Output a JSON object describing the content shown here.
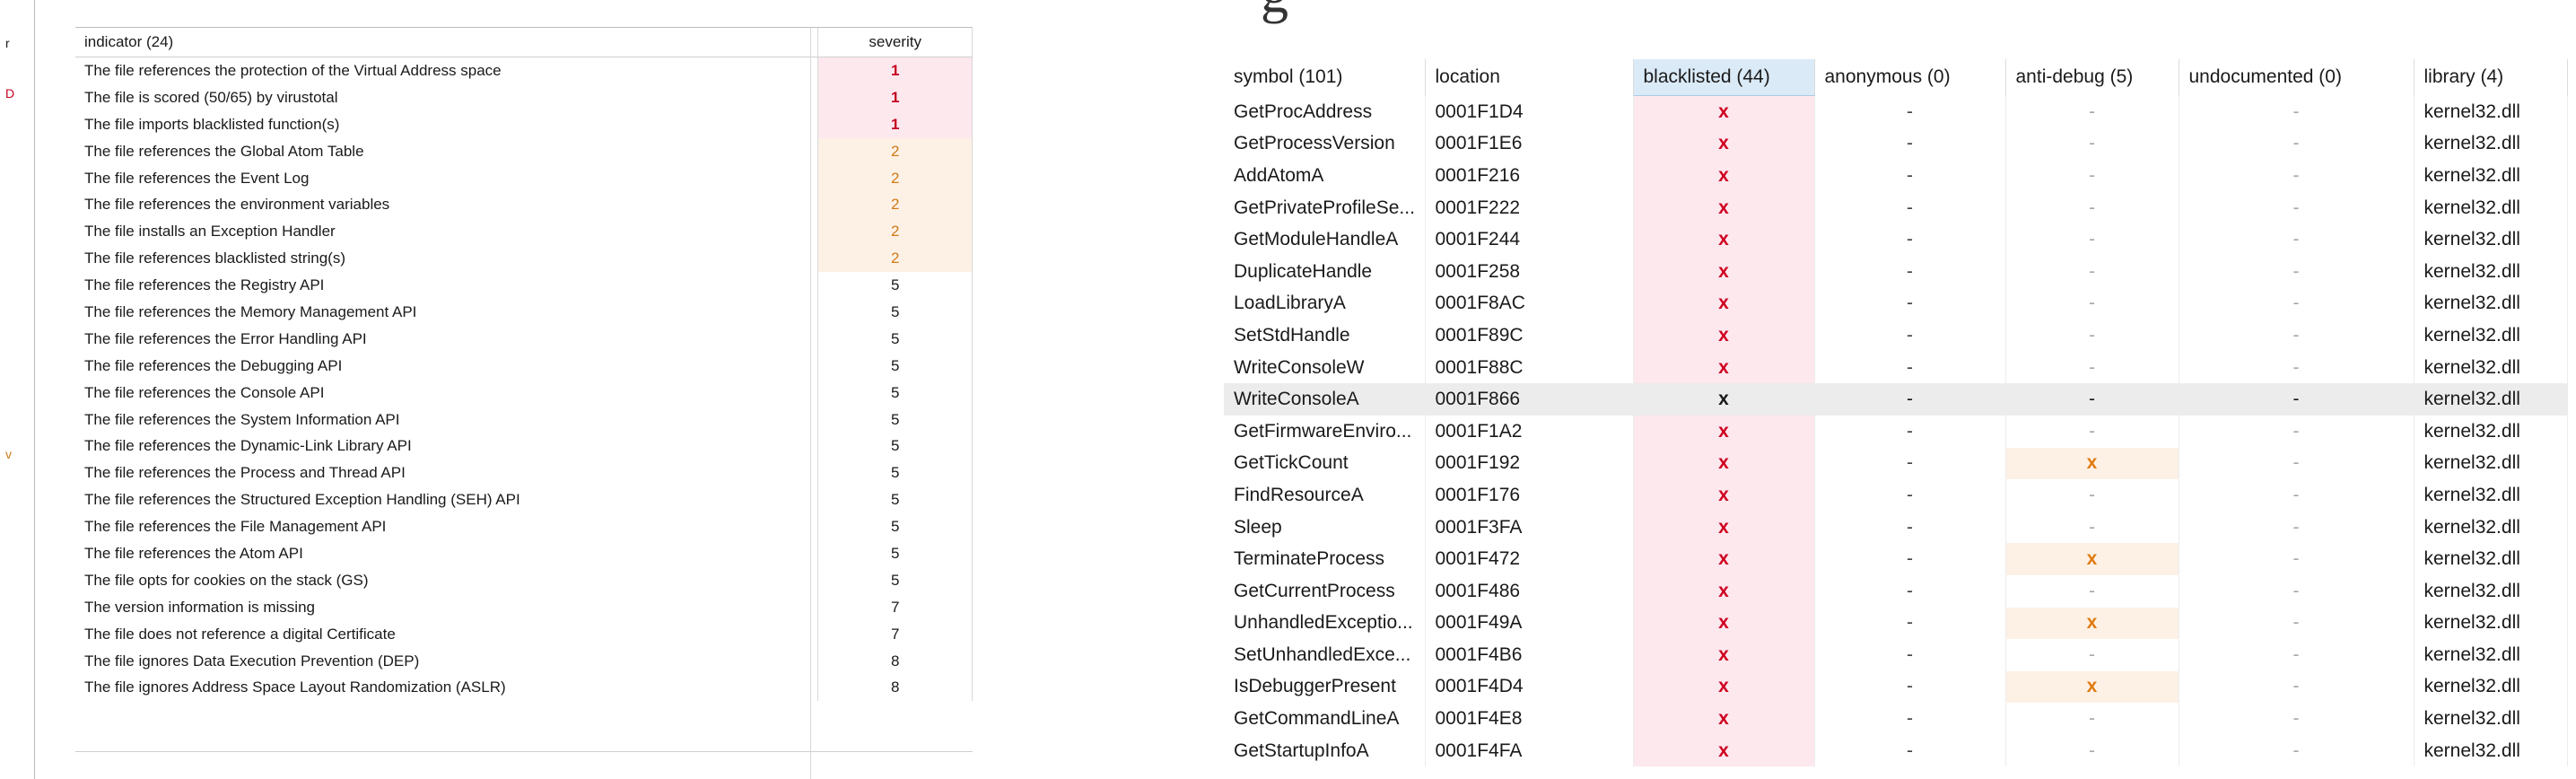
{
  "left_edge_marks": [
    "r",
    "D",
    "v"
  ],
  "indicators": {
    "header": {
      "indicator": "indicator (24)",
      "severity": "severity"
    },
    "rows": [
      {
        "text": "The file references the protection of the Virtual Address space",
        "severity": "1"
      },
      {
        "text": "The file is scored (50/65) by virustotal",
        "severity": "1"
      },
      {
        "text": "The file imports blacklisted function(s)",
        "severity": "1"
      },
      {
        "text": "The file references the Global Atom Table",
        "severity": "2"
      },
      {
        "text": "The file references the Event Log",
        "severity": "2"
      },
      {
        "text": "The file references the environment variables",
        "severity": "2"
      },
      {
        "text": "The file installs an Exception Handler",
        "severity": "2"
      },
      {
        "text": "The file references blacklisted string(s)",
        "severity": "2"
      },
      {
        "text": "The file references the Registry API",
        "severity": "5"
      },
      {
        "text": "The file references the Memory Management API",
        "severity": "5"
      },
      {
        "text": "The file references the Error Handling API",
        "severity": "5"
      },
      {
        "text": "The file references the Debugging API",
        "severity": "5"
      },
      {
        "text": "The file references the Console API",
        "severity": "5"
      },
      {
        "text": "The file references the System Information API",
        "severity": "5"
      },
      {
        "text": "The file references the Dynamic-Link Library API",
        "severity": "5"
      },
      {
        "text": "The file references the Process and Thread API",
        "severity": "5"
      },
      {
        "text": "The file references the Structured Exception Handling (SEH) API",
        "severity": "5"
      },
      {
        "text": "The file references the File Management API",
        "severity": "5"
      },
      {
        "text": "The file references the Atom API",
        "severity": "5"
      },
      {
        "text": "The file opts for cookies on the stack (GS)",
        "severity": "5"
      },
      {
        "text": "The version information is missing",
        "severity": "7"
      },
      {
        "text": "The file does not reference a digital Certificate",
        "severity": "7"
      },
      {
        "text": "The file ignores Data Execution Prevention (DEP)",
        "severity": "8"
      },
      {
        "text": "The file ignores Address Space Layout Randomization (ASLR)",
        "severity": "8"
      }
    ]
  },
  "title_fragment": "g",
  "symbols": {
    "header": {
      "symbol": "symbol (101)",
      "location": "location",
      "blacklisted": "blacklisted (44)",
      "anonymous": "anonymous (0)",
      "anti_debug": "anti-debug (5)",
      "undocumented": "undocumented (0)",
      "library": "library (4)"
    },
    "active_column": "blacklisted",
    "selected_symbol": "WriteConsoleA",
    "rows": [
      {
        "symbol": "GetProcAddress",
        "location": "0001F1D4",
        "blacklisted": "x",
        "anonymous": "-",
        "anti_debug": "-",
        "undocumented": "-",
        "library": "kernel32.dll"
      },
      {
        "symbol": "GetProcessVersion",
        "location": "0001F1E6",
        "blacklisted": "x",
        "anonymous": "-",
        "anti_debug": "-",
        "undocumented": "-",
        "library": "kernel32.dll"
      },
      {
        "symbol": "AddAtomA",
        "location": "0001F216",
        "blacklisted": "x",
        "anonymous": "-",
        "anti_debug": "-",
        "undocumented": "-",
        "library": "kernel32.dll"
      },
      {
        "symbol": "GetPrivateProfileSe...",
        "location": "0001F222",
        "blacklisted": "x",
        "anonymous": "-",
        "anti_debug": "-",
        "undocumented": "-",
        "library": "kernel32.dll"
      },
      {
        "symbol": "GetModuleHandleA",
        "location": "0001F244",
        "blacklisted": "x",
        "anonymous": "-",
        "anti_debug": "-",
        "undocumented": "-",
        "library": "kernel32.dll"
      },
      {
        "symbol": "DuplicateHandle",
        "location": "0001F258",
        "blacklisted": "x",
        "anonymous": "-",
        "anti_debug": "-",
        "undocumented": "-",
        "library": "kernel32.dll"
      },
      {
        "symbol": "LoadLibraryA",
        "location": "0001F8AC",
        "blacklisted": "x",
        "anonymous": "-",
        "anti_debug": "-",
        "undocumented": "-",
        "library": "kernel32.dll"
      },
      {
        "symbol": "SetStdHandle",
        "location": "0001F89C",
        "blacklisted": "x",
        "anonymous": "-",
        "anti_debug": "-",
        "undocumented": "-",
        "library": "kernel32.dll"
      },
      {
        "symbol": "WriteConsoleW",
        "location": "0001F88C",
        "blacklisted": "x",
        "anonymous": "-",
        "anti_debug": "-",
        "undocumented": "-",
        "library": "kernel32.dll"
      },
      {
        "symbol": "WriteConsoleA",
        "location": "0001F866",
        "blacklisted": "x",
        "anonymous": "-",
        "anti_debug": "-",
        "undocumented": "-",
        "library": "kernel32.dll"
      },
      {
        "symbol": "GetFirmwareEnviro...",
        "location": "0001F1A2",
        "blacklisted": "x",
        "anonymous": "-",
        "anti_debug": "-",
        "undocumented": "-",
        "library": "kernel32.dll"
      },
      {
        "symbol": "GetTickCount",
        "location": "0001F192",
        "blacklisted": "x",
        "anonymous": "-",
        "anti_debug": "x",
        "undocumented": "-",
        "library": "kernel32.dll"
      },
      {
        "symbol": "FindResourceA",
        "location": "0001F176",
        "blacklisted": "x",
        "anonymous": "-",
        "anti_debug": "-",
        "undocumented": "-",
        "library": "kernel32.dll"
      },
      {
        "symbol": "Sleep",
        "location": "0001F3FA",
        "blacklisted": "x",
        "anonymous": "-",
        "anti_debug": "-",
        "undocumented": "-",
        "library": "kernel32.dll"
      },
      {
        "symbol": "TerminateProcess",
        "location": "0001F472",
        "blacklisted": "x",
        "anonymous": "-",
        "anti_debug": "x",
        "undocumented": "-",
        "library": "kernel32.dll"
      },
      {
        "symbol": "GetCurrentProcess",
        "location": "0001F486",
        "blacklisted": "x",
        "anonymous": "-",
        "anti_debug": "-",
        "undocumented": "-",
        "library": "kernel32.dll"
      },
      {
        "symbol": "UnhandledExceptio...",
        "location": "0001F49A",
        "blacklisted": "x",
        "anonymous": "-",
        "anti_debug": "x",
        "undocumented": "-",
        "library": "kernel32.dll"
      },
      {
        "symbol": "SetUnhandledExce...",
        "location": "0001F4B6",
        "blacklisted": "x",
        "anonymous": "-",
        "anti_debug": "-",
        "undocumented": "-",
        "library": "kernel32.dll"
      },
      {
        "symbol": "IsDebuggerPresent",
        "location": "0001F4D4",
        "blacklisted": "x",
        "anonymous": "-",
        "anti_debug": "x",
        "undocumented": "-",
        "library": "kernel32.dll"
      },
      {
        "symbol": "GetCommandLineA",
        "location": "0001F4E8",
        "blacklisted": "x",
        "anonymous": "-",
        "anti_debug": "-",
        "undocumented": "-",
        "library": "kernel32.dll"
      },
      {
        "symbol": "GetStartupInfoA",
        "location": "0001F4FA",
        "blacklisted": "x",
        "anonymous": "-",
        "anti_debug": "-",
        "undocumented": "-",
        "library": "kernel32.dll"
      }
    ]
  },
  "colors": {
    "severity_high_bg": "#fde8ee",
    "severity_high_text": "#c4001f",
    "severity_medium_bg": "#fdf1e6",
    "severity_medium_text": "#d27a14",
    "blacklisted_bg": "#fde8ee",
    "blacklisted_mark": "#d0001f",
    "anti_debug_bg": "#fdf1e6",
    "anti_debug_mark": "#e07b10",
    "active_header_bg": "#dbeaf7",
    "selected_row_bg": "#ececec"
  }
}
